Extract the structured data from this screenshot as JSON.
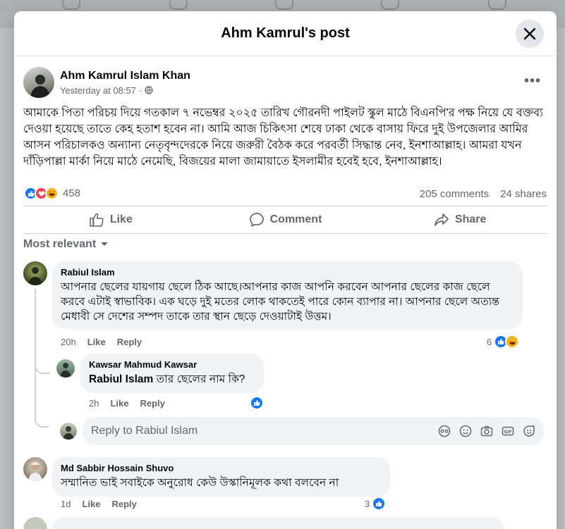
{
  "modal": {
    "title": "Ahm Kamrul's post"
  },
  "post": {
    "author": "Ahm Kamrul Islam Khan",
    "timestamp": "Yesterday at 08:57",
    "separator": "·",
    "text": "আমাকে পিতা পরিচয় দিয়ে গতকাল ৭ নভেম্বর ২০২৫ তারিখ গৌরনদী পাইলট স্কুল মাঠে বিএনপি'র পক্ষ নিয়ে যে বক্তব্য দেওয়া হয়েছে তাতে কেহ হতাশ হবেন না। আমি আজ চিকিৎসা শেষে ঢাকা থেকে বাসায় ফিরে দুই উপজেলার আমির আসন পরিচালকও অন্যান্য নেতৃবৃন্দদেরকে নিয়ে জরুরী বৈঠক করে পরবর্তী সিদ্ধান্ত নেব, ইনশাআল্লাহ। আমরা যখন দাঁড়িপাল্লা মার্কা নিয়ে মাঠে নেমেছি, বিজয়ের মালা জামায়াতে ইসলামীর হবেই হবে, ইনশাআল্লাহ।",
    "reaction_count": "458",
    "comments_count": "205 comments",
    "shares_count": "24 shares",
    "reaction_icons": [
      "like-icon",
      "love-icon",
      "haha-icon"
    ]
  },
  "actions": {
    "like": "Like",
    "comment": "Comment",
    "share": "Share"
  },
  "sort": {
    "label": "Most relevant"
  },
  "comments": [
    {
      "name": "Rabiul Islam",
      "text": "আপনার ছেলের যায়গায় ছেলে ঠিক আছে।আপনার কাজ আপনি করবেন আপনার ছেলের কাজ ছেলে করবে এটাই স্বাভাবিক। এক ঘড়ে দুই মতের লোক থাকতেই পারে কোন ব্যাপার না। আপনার ছেলে অত্যন্ত মেধাবী সে দেশের সম্পদ তাকে তার স্থান ছেড়ে দেওয়াটাই উত্তম।",
      "time": "20h",
      "like": "Like",
      "reply": "Reply",
      "reactions": "6"
    },
    {
      "name": "Kawsar Mahmud Kawsar",
      "mention": "Rabiul Islam",
      "text": "তার ছেলের নাম কি?",
      "time": "2h",
      "like": "Like",
      "reply": "Reply"
    },
    {
      "name": "Md Sabbir Hossain Shuvo",
      "text": "সম্মানিত ভাই সবাইকে অনুরোধ কেউ উস্কানিমূলক কথা বলবেন না",
      "time": "1d",
      "like": "Like",
      "reply": "Reply",
      "reactions": "3"
    }
  ],
  "reply_box": {
    "placeholder": "Reply to Rabiul Islam",
    "icons": [
      "avatar-sticker-icon",
      "emoji-icon",
      "camera-icon",
      "gif-icon",
      "sticker-icon"
    ]
  },
  "colors": {
    "like_blue": "#1877f2",
    "love_red": "#f33e58",
    "haha_yellow": "#f7b125",
    "text_secondary": "#65676b"
  }
}
